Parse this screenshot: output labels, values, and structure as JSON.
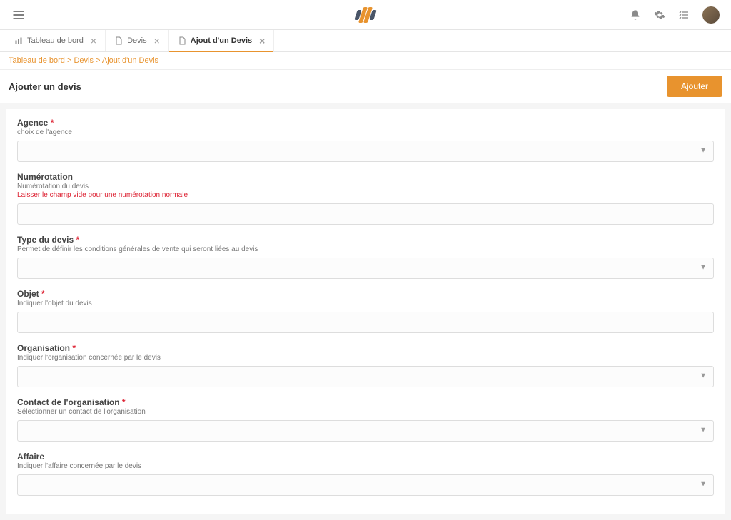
{
  "header": {
    "icons": {
      "menu": "menu",
      "bell": "bell",
      "gear": "gear",
      "list": "list",
      "avatar": "avatar"
    }
  },
  "tabs": [
    {
      "label": "Tableau de bord",
      "active": false
    },
    {
      "label": "Devis",
      "active": false
    },
    {
      "label": "Ajout d'un Devis",
      "active": true
    }
  ],
  "breadcrumb": {
    "parts": [
      "Tableau de bord",
      "Devis",
      "Ajout d'un Devis"
    ]
  },
  "page": {
    "title": "Ajouter un devis",
    "action_label": "Ajouter"
  },
  "form": {
    "agence": {
      "label": "Agence",
      "required": true,
      "hint": "choix de l'agence",
      "value": ""
    },
    "numerotation": {
      "label": "Numérotation",
      "required": false,
      "hint": "Numérotation du devis",
      "warn": "Laisser le champ vide pour une numérotation normale",
      "value": ""
    },
    "type": {
      "label": "Type du devis",
      "required": true,
      "hint": "Permet de définir les conditions générales de vente qui seront liées au devis",
      "value": ""
    },
    "objet": {
      "label": "Objet",
      "required": true,
      "hint": "Indiquer l'objet du devis",
      "value": ""
    },
    "organisation": {
      "label": "Organisation",
      "required": true,
      "hint": "Indiquer l'organisation concernée par le devis",
      "value": ""
    },
    "contact": {
      "label": "Contact de l'organisation",
      "required": true,
      "hint": "Sélectionner un contact de l'organisation",
      "value": ""
    },
    "affaire": {
      "label": "Affaire",
      "required": false,
      "hint": "Indiquer l'affaire concernée par le devis",
      "value": ""
    }
  }
}
